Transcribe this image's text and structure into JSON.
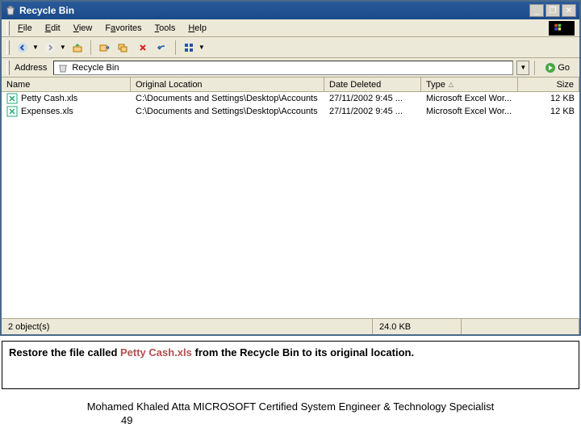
{
  "titlebar": {
    "title": "Recycle Bin"
  },
  "menubar": {
    "items": [
      {
        "pre": "",
        "u": "F",
        "post": "ile"
      },
      {
        "pre": "",
        "u": "E",
        "post": "dit"
      },
      {
        "pre": "",
        "u": "V",
        "post": "iew"
      },
      {
        "pre": "F",
        "u": "a",
        "post": "vorites"
      },
      {
        "pre": "",
        "u": "T",
        "post": "ools"
      },
      {
        "pre": "",
        "u": "H",
        "post": "elp"
      }
    ]
  },
  "addressbar": {
    "label": "Address",
    "value": "Recycle Bin",
    "go": "Go"
  },
  "columns": {
    "name": "Name",
    "location": "Original Location",
    "date": "Date Deleted",
    "type": "Type",
    "size": "Size",
    "sort": "△"
  },
  "files": [
    {
      "name": "Petty Cash.xls",
      "location": "C:\\Documents and Settings\\Desktop\\Accounts",
      "date": "27/11/2002 9:45 ...",
      "type": "Microsoft Excel Wor...",
      "size": "12 KB"
    },
    {
      "name": "Expenses.xls",
      "location": "C:\\Documents and Settings\\Desktop\\Accounts",
      "date": "27/11/2002 9:45 ...",
      "type": "Microsoft Excel Wor...",
      "size": "12 KB"
    }
  ],
  "statusbar": {
    "objects": "2 object(s)",
    "total": "24.0 KB"
  },
  "instruction": {
    "pre": "Restore the file called ",
    "highlight": "Petty Cash.xls",
    "post": " from the Recycle Bin to its original location."
  },
  "footer": {
    "text": "Mohamed Khaled Atta MICROSOFT Certified System Engineer & Technology Specialist",
    "page": "49"
  }
}
